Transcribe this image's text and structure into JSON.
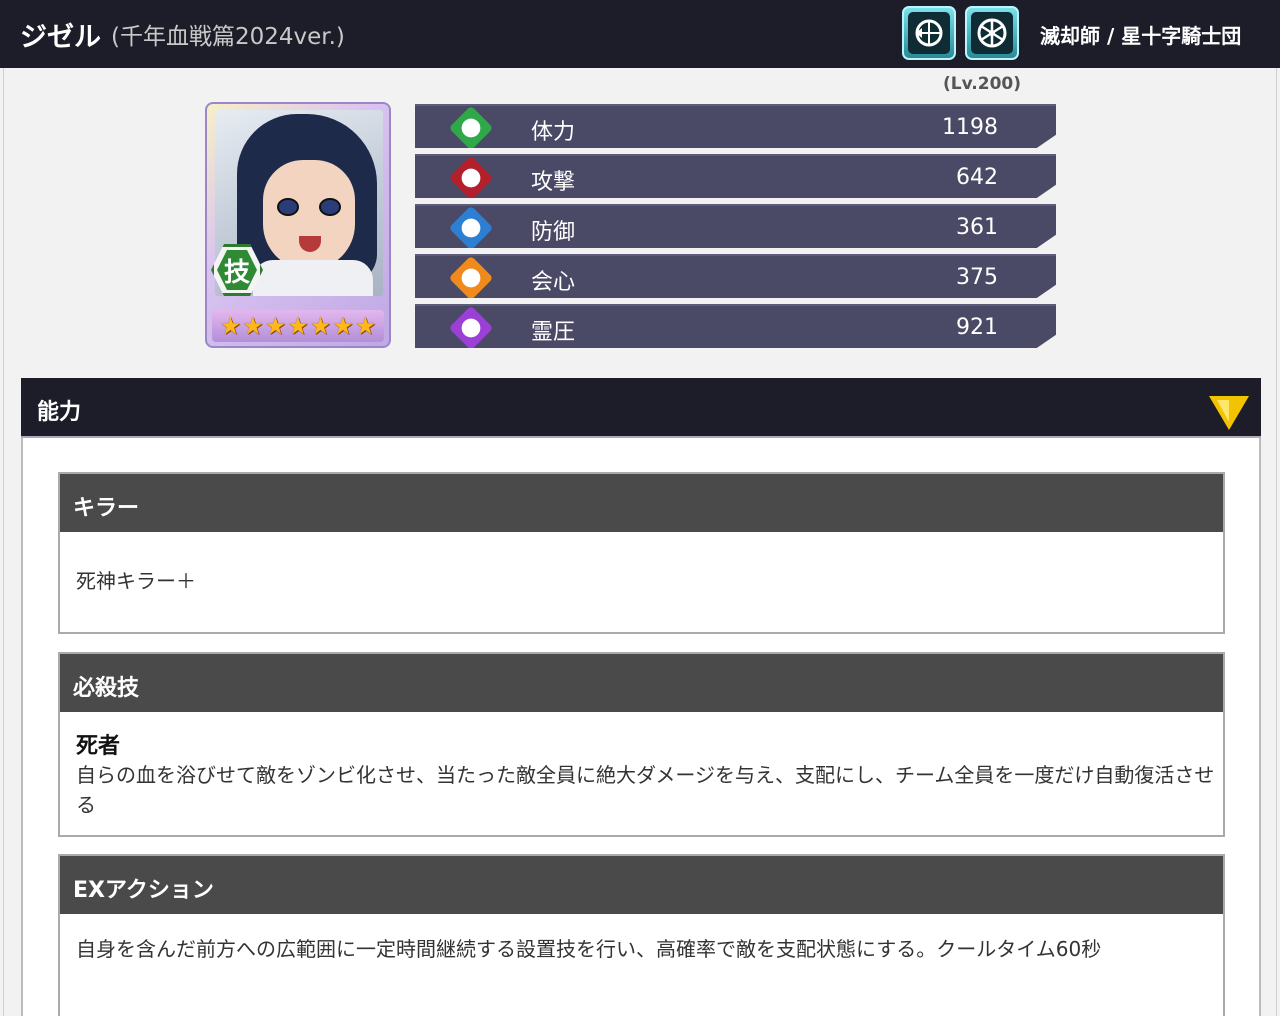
{
  "header": {
    "name": "ジゼル",
    "version": "(千年血戦篇2024ver.)",
    "affiliation": "滅却師 / 星十字騎士団",
    "type_icons": [
      "bow-type-icon",
      "wheel-type-icon"
    ]
  },
  "card": {
    "skill_badge": "技",
    "stars": [
      "★",
      "★",
      "★",
      "★",
      "★",
      "★",
      "★"
    ]
  },
  "stats": {
    "level": "(Lv.200)",
    "rows": [
      {
        "label": "体力",
        "value": "1198",
        "color": "#2fa84a"
      },
      {
        "label": "攻撃",
        "value": "642",
        "color": "#b3202b"
      },
      {
        "label": "防御",
        "value": "361",
        "color": "#2d7fd3"
      },
      {
        "label": "会心",
        "value": "375",
        "color": "#f08a1c"
      },
      {
        "label": "霊圧",
        "value": "921",
        "color": "#9b3fd6"
      }
    ]
  },
  "ability": {
    "title": "能力",
    "sections": [
      {
        "heading": "キラー",
        "text": "死神キラー＋"
      },
      {
        "heading": "必殺技",
        "skill_name": "死者",
        "text": "自らの血を浴びせて敵をゾンビ化させ、当たった敵全員に絶大ダメージを与え、支配にし、チーム全員を一度だけ自動復活させる"
      },
      {
        "heading": "EXアクション",
        "text": "自身を含んだ前方への広範囲に一定時間継続する設置技を行い、高確率で敵を支配状態にする。クールタイム60秒"
      }
    ]
  },
  "colors": {
    "header_bg": "#1c1d29",
    "section_head_bg": "#4a4a4a",
    "stat_bg": "#4b4a66",
    "toggle": "#f2c300"
  }
}
